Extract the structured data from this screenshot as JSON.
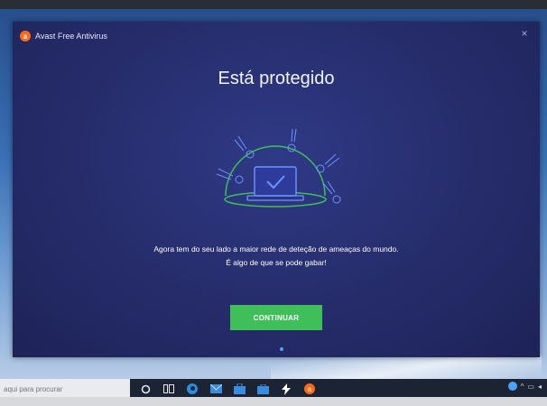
{
  "app": {
    "title": "Avast Free Antivirus",
    "close_symbol": "×"
  },
  "main": {
    "heading": "Está protegido",
    "subtitle_line1": "Agora tem do seu lado a maior rede de deteção de ameaças do mundo.",
    "subtitle_line2": "É algo de que se pode gabar!",
    "continue_label": "CONTINUAR"
  },
  "taskbar": {
    "search_placeholder": "aqui para procurar",
    "icons": [
      "cortana-circle-icon",
      "task-view-icon",
      "edge-icon",
      "mail-icon",
      "store-icon",
      "briefcase-icon",
      "flash-icon",
      "avast-icon"
    ]
  },
  "colors": {
    "window_bg": "#262c6a",
    "accent_green": "#3fbf5a",
    "brand_orange": "#ff6a1a",
    "illustration_blue": "#6f93ff"
  }
}
